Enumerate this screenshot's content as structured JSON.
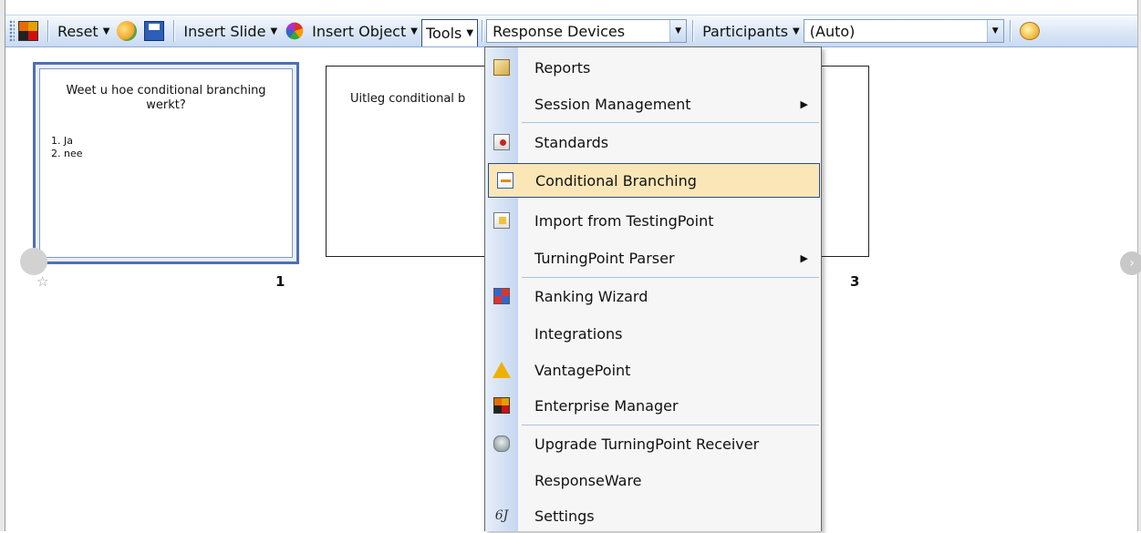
{
  "toolbar": {
    "reset_label": "Reset",
    "insert_slide_label": "Insert Slide",
    "insert_object_label": "Insert Object",
    "tools_label": "Tools",
    "response_devices_value": "Response Devices",
    "participants_label": "Participants",
    "participants_value": "(Auto)"
  },
  "slides": [
    {
      "number": "1",
      "title": "Weet u hoe conditional branching werkt?",
      "items": [
        "1. Ja",
        "2. nee"
      ]
    },
    {
      "number": "",
      "title": "Uitleg conditional b"
    },
    {
      "number": "3"
    }
  ],
  "tools_menu": {
    "items": [
      {
        "label": "Reports",
        "icon": "reports-icon"
      },
      {
        "label": "Session Management",
        "submenu": true
      },
      {
        "label": "Standards",
        "icon": "standards-icon"
      },
      {
        "label": "Conditional Branching",
        "icon": "conditional-branching-icon",
        "highlighted": true
      },
      {
        "label": "Import from TestingPoint",
        "icon": "import-icon"
      },
      {
        "label": "TurningPoint Parser",
        "submenu": true
      },
      {
        "label": "Ranking Wizard",
        "icon": "ranking-wizard-icon"
      },
      {
        "label": "Integrations"
      },
      {
        "label": "VantagePoint",
        "icon": "warning-triangle-icon"
      },
      {
        "label": "Enterprise Manager",
        "icon": "enterprise-manager-icon"
      },
      {
        "label": "Upgrade TurningPoint Receiver",
        "icon": "receiver-icon"
      },
      {
        "label": "ResponseWare"
      },
      {
        "label": "Settings",
        "icon": "settings-icon",
        "icon_text": "6J"
      }
    ]
  },
  "colors": {
    "toolbar_gradient_top": "#f7fafe",
    "toolbar_gradient_bottom": "#c9daf2",
    "menu_highlight": "#fbe6b7",
    "selection_border": "#4f6fb2"
  }
}
